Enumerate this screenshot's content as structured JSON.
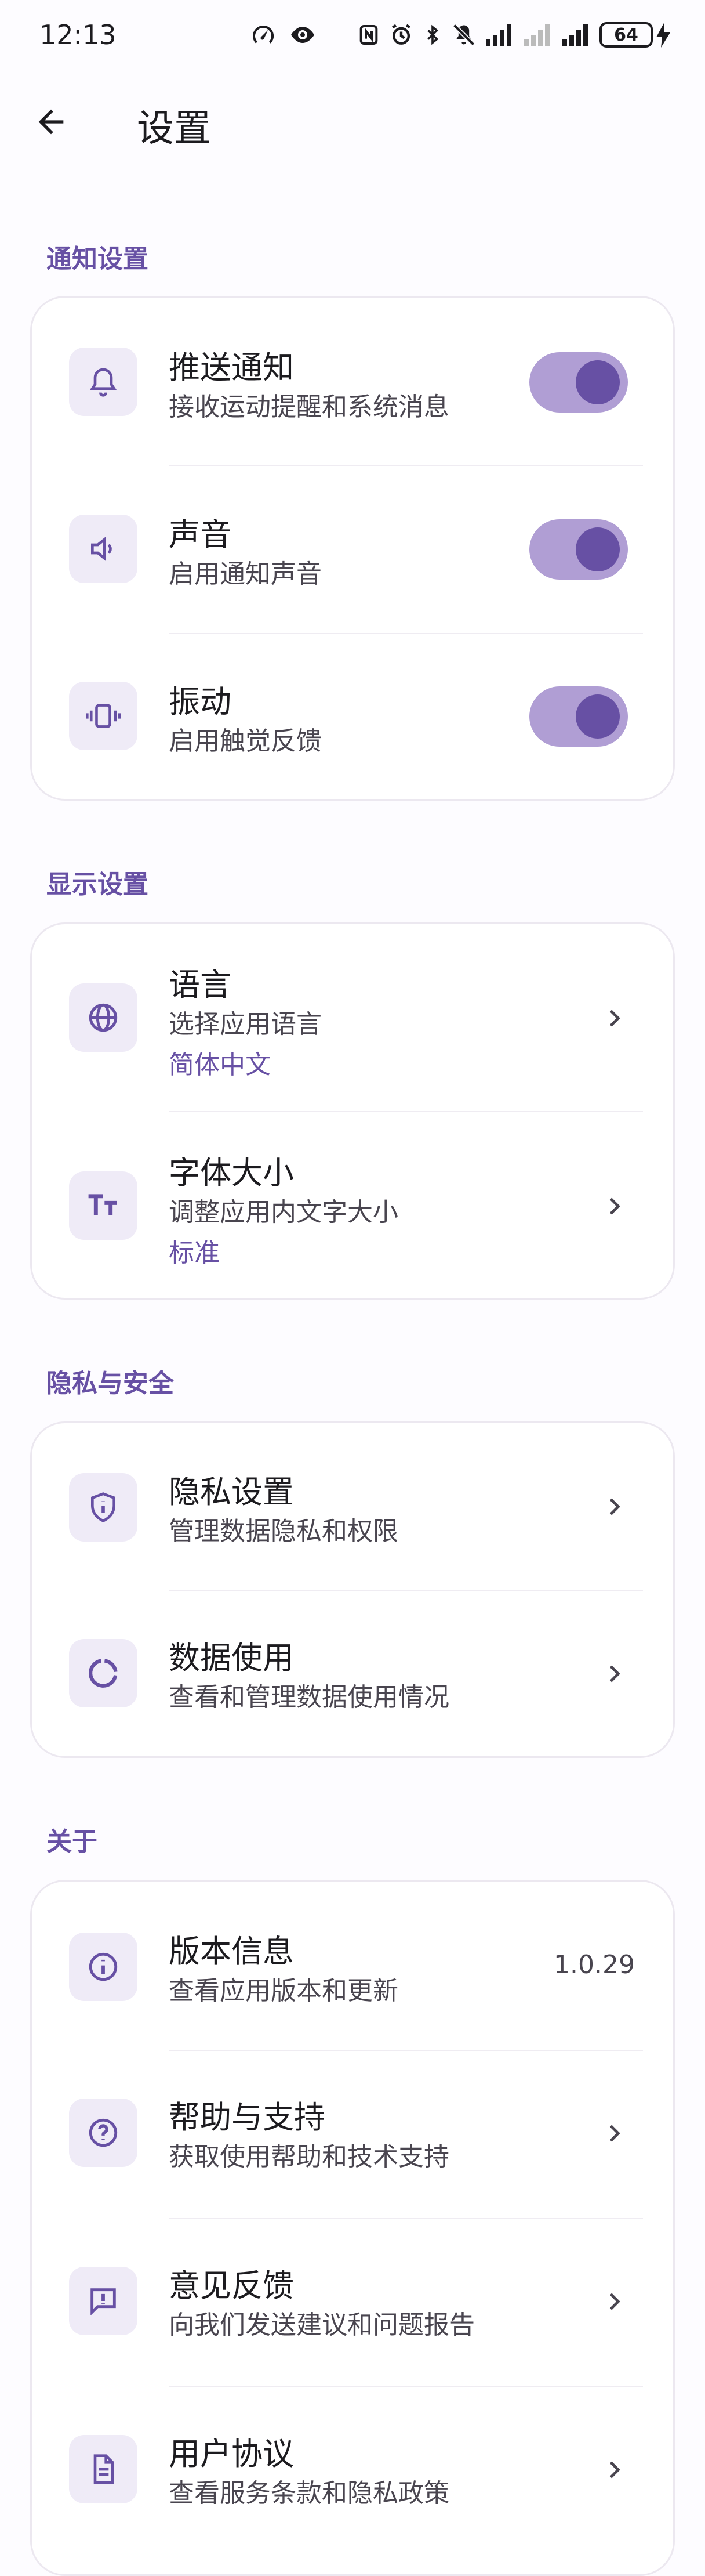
{
  "status_bar": {
    "time": "12:13",
    "battery": "64"
  },
  "app_bar": {
    "title": "设置"
  },
  "sections": [
    {
      "label": "通知设置",
      "items": [
        {
          "title": "推送通知",
          "subtitle": "接收运动提醒和系统消息",
          "icon": "bell-icon",
          "toggle": true
        },
        {
          "title": "声音",
          "subtitle": "启用通知声音",
          "icon": "speaker-icon",
          "toggle": true
        },
        {
          "title": "振动",
          "subtitle": "启用触觉反馈",
          "icon": "vibrate-icon",
          "toggle": true
        }
      ]
    },
    {
      "label": "显示设置",
      "items": [
        {
          "title": "语言",
          "subtitle": "选择应用语言",
          "value": "简体中文",
          "icon": "globe-icon"
        },
        {
          "title": "字体大小",
          "subtitle": "调整应用内文字大小",
          "value": "标准",
          "icon": "text-size-icon"
        }
      ]
    },
    {
      "label": "隐私与安全",
      "items": [
        {
          "title": "隐私设置",
          "subtitle": "管理数据隐私和权限",
          "icon": "shield-icon"
        },
        {
          "title": "数据使用",
          "subtitle": "查看和管理数据使用情况",
          "icon": "data-usage-icon"
        }
      ]
    },
    {
      "label": "关于",
      "items": [
        {
          "title": "版本信息",
          "subtitle": "查看应用版本和更新",
          "version": "1.0.29",
          "icon": "info-icon"
        },
        {
          "title": "帮助与支持",
          "subtitle": "获取使用帮助和技术支持",
          "icon": "help-icon"
        },
        {
          "title": "意见反馈",
          "subtitle": "向我们发送建议和问题报告",
          "icon": "feedback-icon"
        },
        {
          "title": "用户协议",
          "subtitle": "查看服务条款和隐私政策",
          "icon": "document-icon"
        }
      ]
    }
  ],
  "colors": {
    "accent": "#6750a4",
    "toggle_track": "#b09ed4",
    "icon_bg": "#efebf7"
  }
}
